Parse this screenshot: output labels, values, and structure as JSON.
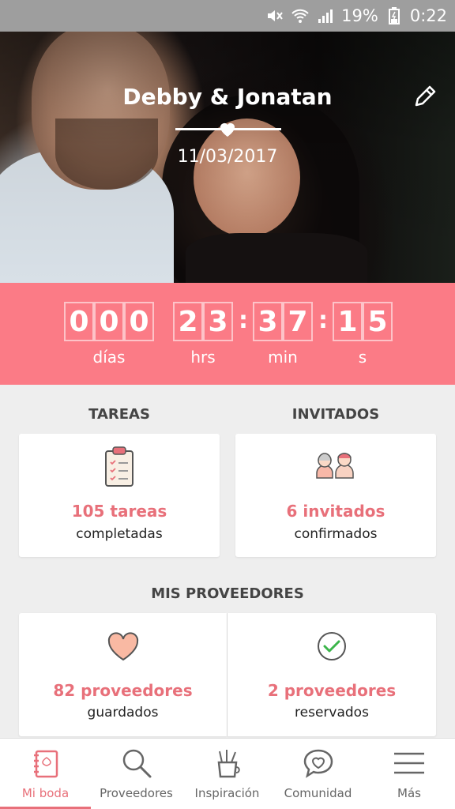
{
  "status_bar": {
    "battery": "19%",
    "time": "0:22",
    "icons": [
      "mute-icon",
      "wifi-icon",
      "signal-icon",
      "battery-icon"
    ]
  },
  "header": {
    "couple_name": "Debby & Jonatan",
    "date": "11/03/2017",
    "edit_icon": "pencil-icon",
    "divider_icon": "heart-icon"
  },
  "countdown": {
    "days": [
      "0",
      "0",
      "0"
    ],
    "hours": [
      "2",
      "3"
    ],
    "minutes": [
      "3",
      "7"
    ],
    "seconds": [
      "1",
      "5"
    ],
    "separator": ":",
    "labels": {
      "days": "días",
      "hours": "hrs",
      "minutes": "min",
      "seconds": "s"
    }
  },
  "tasks": {
    "title": "TAREAS",
    "value": "105 tareas",
    "sub": "completadas",
    "icon": "clipboard-icon"
  },
  "guests": {
    "title": "INVITADOS",
    "value": "6 invitados",
    "sub": "confirmados",
    "icon": "guests-icon"
  },
  "vendors": {
    "title": "MIS PROVEEDORES",
    "saved": {
      "value": "82 proveedores",
      "sub": "guardados",
      "icon": "heart-icon"
    },
    "booked": {
      "value": "2 proveedores",
      "sub": "reservados",
      "icon": "check-circle-icon"
    }
  },
  "nav": [
    {
      "label": "Mi boda",
      "icon": "notebook-icon",
      "active": true
    },
    {
      "label": "Proveedores",
      "icon": "search-icon",
      "active": false
    },
    {
      "label": "Inspiración",
      "icon": "pencil-cup-icon",
      "active": false
    },
    {
      "label": "Comunidad",
      "icon": "chat-heart-icon",
      "active": false
    },
    {
      "label": "Más",
      "icon": "menu-icon",
      "active": false
    }
  ],
  "colors": {
    "accent": "#fb7b86",
    "accent_text": "#e8707a",
    "background": "#eeeeee"
  }
}
